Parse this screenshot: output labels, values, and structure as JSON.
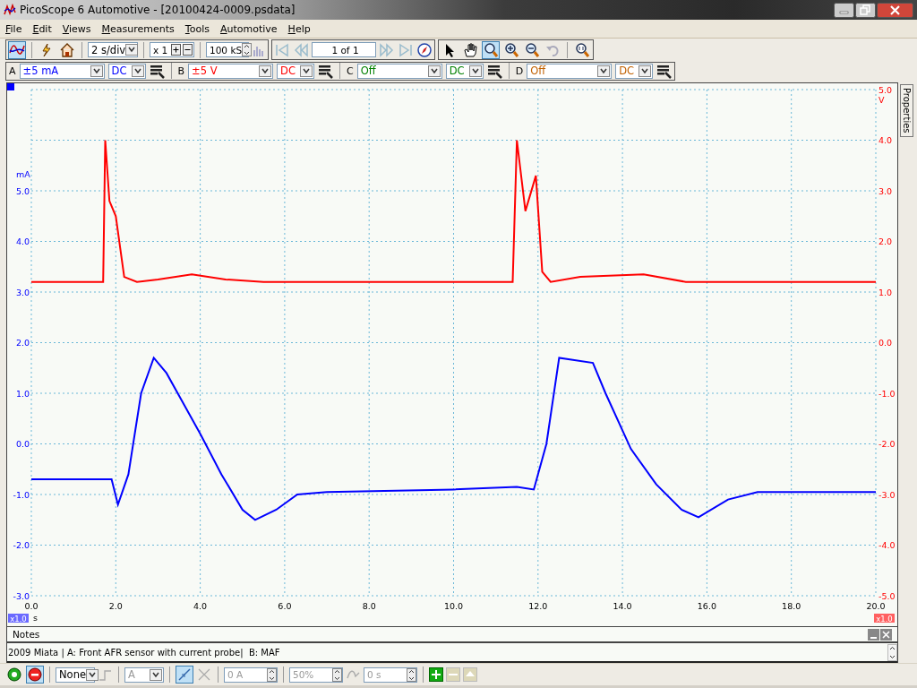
{
  "window": {
    "title": "PicoScope 6 Automotive - [20100424-0009.psdata]"
  },
  "menu": [
    {
      "label": "File"
    },
    {
      "label": "Edit"
    },
    {
      "label": "Views"
    },
    {
      "label": "Measurements"
    },
    {
      "label": "Tools"
    },
    {
      "label": "Automotive"
    },
    {
      "label": "Help"
    }
  ],
  "toolbar": {
    "scope_mode_selected": true,
    "timebase": "2 s/div",
    "zoom": "x 1",
    "samples": "100 kS",
    "buffer": "1 of 1",
    "tools": [
      {
        "kind": "pointer",
        "selected": false
      },
      {
        "kind": "hand",
        "selected": false
      },
      {
        "kind": "zoom-area",
        "selected": true
      },
      {
        "kind": "zoom-in",
        "selected": false
      },
      {
        "kind": "zoom-out",
        "selected": false
      },
      {
        "kind": "undo",
        "selected": false
      },
      {
        "kind": "zoom-overview",
        "selected": false
      }
    ]
  },
  "channels": [
    {
      "letter": "A",
      "range": "±5 mA",
      "coupling": "DC",
      "color": "#0000ff"
    },
    {
      "letter": "B",
      "range": "±5 V",
      "coupling": "DC",
      "color": "#ff0000"
    },
    {
      "letter": "C",
      "range": "Off",
      "coupling": "DC",
      "color": "#008000"
    },
    {
      "letter": "D",
      "range": "Off",
      "coupling": "DC",
      "color": "#c06000"
    }
  ],
  "scope": {
    "left_zoom": "x1.0",
    "right_zoom": "x1.0",
    "chart_data": {
      "type": "line",
      "xlabel": "s",
      "ylabel": "mA",
      "y2label": "V",
      "grid": true,
      "xlim": [
        0,
        20
      ],
      "ylim": [
        -3,
        7
      ],
      "y2lim": [
        -5,
        5
      ],
      "y2ticks": [
        {
          "value": 5,
          "label": "5.0"
        },
        {
          "value": 4,
          "label": "4.0"
        },
        {
          "value": 3,
          "label": "3.0"
        },
        {
          "value": 2,
          "label": "2.0"
        },
        {
          "value": 1,
          "label": "1.0"
        },
        {
          "value": 0,
          "label": "0.0"
        },
        {
          "value": -1,
          "label": "-1.0"
        },
        {
          "value": -2,
          "label": "-2.0"
        },
        {
          "value": -3,
          "label": "-3.0"
        },
        {
          "value": -4,
          "label": "-4.0"
        },
        {
          "value": -5,
          "label": "-5.0"
        }
      ],
      "xticks": [
        {
          "value": 0,
          "label": "0.0"
        },
        {
          "value": 2,
          "label": "2.0"
        },
        {
          "value": 4,
          "label": "4.0"
        },
        {
          "value": 6,
          "label": "6.0"
        },
        {
          "value": 8,
          "label": "8.0"
        },
        {
          "value": 10,
          "label": "10.0"
        },
        {
          "value": 12,
          "label": "12.0"
        },
        {
          "value": 14,
          "label": "14.0"
        },
        {
          "value": 16,
          "label": "16.0"
        },
        {
          "value": 18,
          "label": "18.0"
        },
        {
          "value": 20,
          "label": "20.0"
        }
      ],
      "yticks": [
        {
          "value": 5,
          "label": "5.0"
        },
        {
          "value": 4,
          "label": "4.0"
        },
        {
          "value": 3,
          "label": "3.0"
        },
        {
          "value": 2,
          "label": "2.0"
        },
        {
          "value": 1,
          "label": "1.0"
        },
        {
          "value": 0,
          "label": "0.0"
        },
        {
          "value": -1,
          "label": "-1.0"
        },
        {
          "value": -2,
          "label": "-2.0"
        },
        {
          "value": -3,
          "label": "-3.0"
        }
      ],
      "series": [
        {
          "color": "#0000ff",
          "x": [
            0,
            1.9,
            2.05,
            2.3,
            2.6,
            2.9,
            3.2,
            3.6,
            4.0,
            4.5,
            5.0,
            5.3,
            5.8,
            6.3,
            7.0,
            10.0,
            11.5,
            11.9,
            12.2,
            12.5,
            13.3,
            13.6,
            14.2,
            14.8,
            15.4,
            15.8,
            16.5,
            17.2,
            20.0
          ],
          "values": [
            -0.7,
            -0.7,
            -1.2,
            -0.6,
            1.0,
            1.7,
            1.4,
            0.8,
            0.2,
            -0.6,
            -1.3,
            -1.5,
            -1.3,
            -1.0,
            -0.95,
            -0.9,
            -0.85,
            -0.9,
            0.0,
            1.7,
            1.6,
            1.0,
            -0.1,
            -0.8,
            -1.3,
            -1.45,
            -1.1,
            -0.95,
            -0.95
          ]
        },
        {
          "color": "#ff0000",
          "axis": "y2",
          "x": [
            0,
            1.7,
            1.75,
            1.85,
            2.0,
            2.2,
            2.5,
            3.0,
            3.8,
            4.6,
            5.5,
            11.4,
            11.5,
            11.7,
            11.95,
            12.1,
            12.3,
            13.0,
            14.5,
            15.5,
            20.0
          ],
          "values": [
            1.2,
            1.2,
            4.0,
            2.8,
            2.5,
            1.3,
            1.2,
            1.25,
            1.35,
            1.25,
            1.2,
            1.2,
            4.0,
            2.6,
            3.3,
            1.4,
            1.2,
            1.3,
            1.35,
            1.2,
            1.2
          ]
        }
      ]
    }
  },
  "notes": {
    "title": "Notes",
    "text": "2009 Miata | A: Front AFR sensor with current probe|  B: MAF"
  },
  "side_tab": {
    "label": "Properties"
  },
  "trigger": {
    "run": [
      {
        "kind": "start",
        "selected": false
      },
      {
        "kind": "stop",
        "selected": true
      }
    ],
    "mode": "None",
    "channel": "A",
    "threshold": "0 A",
    "pretrigger": "50%",
    "delay": "0 s"
  }
}
